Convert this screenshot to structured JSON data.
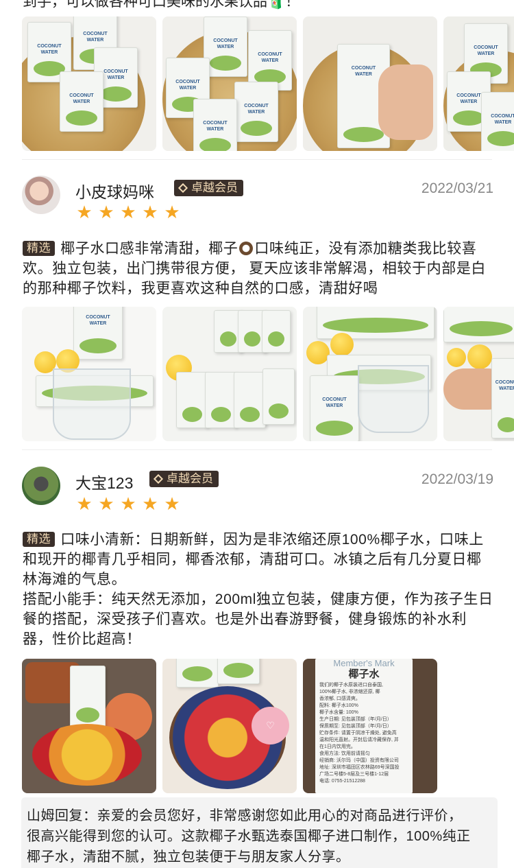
{
  "top_snippet": "到手，可以做各种可口美味的水果饮品🧃！",
  "carton_label": "COCONUT\nWATER",
  "reviews": [
    {
      "username": "小皮球妈咪",
      "badge": "卓越会员",
      "date": "2022/03/21",
      "rating": 5,
      "tag": "精选",
      "text_a": "椰子水口感非常清甜，椰子",
      "coconut_emoji": "🥥",
      "text_b": "口味纯正，没有添加糖类我比较喜欢。独立包装，出门携带很方便， 夏天应该非常解渴，相较于内部是白的那种椰子饮料，我更喜欢这种自然的口感，清甜好喝"
    },
    {
      "username": "大宝123",
      "badge": "卓越会员",
      "date": "2022/03/19",
      "rating": 5,
      "tag": "精选",
      "text_a": "口味小清新：日期新鲜，因为是非浓缩还原100%椰子水，口味上和现开的椰青几乎相同，椰香浓郁，清甜可口。冰镇之后有几分夏日椰林海滩的气息。",
      "text_b": "搭配小能手：纯天然无添加，200ml独立包装，健康方便，作为孩子生日餐的搭配，深受孩子们喜欢。也是外出春游野餐，健身锻炼的补水利器，性价比超高！"
    }
  ],
  "reply": {
    "text": "山姆回复：亲爱的会员您好，非常感谢您如此用心的对商品进行评价，很高兴能得到您的认可。这款椰子水甄选泰国椰子进口制作，100%纯正椰子水，清甜不腻，独立包装便于与朋友家人分享。"
  },
  "label_photo": {
    "brand": "Member's Mark",
    "title": "椰子水",
    "lines": [
      "我们的椰子水原装进口自泰国,",
      "100%椰子水, 非浓缩还原, 椰",
      "香浓郁, 口感清爽。",
      "配料: 椰子水100%",
      "椰子水含量: 100%",
      "生产日期: 见包装顶部（年/月/日）",
      "保质期至: 见包装顶部（年/月/日）",
      "贮存条件: 请置于阴凉干燥处, 避免高",
      "温和阳光直射。开封后请冷藏保存, 并",
      "在1日内饮用完。",
      "食用方法: 饮用前请摇匀",
      "经销商: 沃尔玛（中国）投资有限公司",
      "地址: 深圳市福田区农林路69号深国投",
      "广场二号楼5-8层及三号楼1-12层",
      "电话: 0755-21512288"
    ]
  },
  "colors": {
    "star": "#f5a623",
    "badge_bg": "#3a2f2a",
    "badge_fg": "#f0d9b5"
  }
}
